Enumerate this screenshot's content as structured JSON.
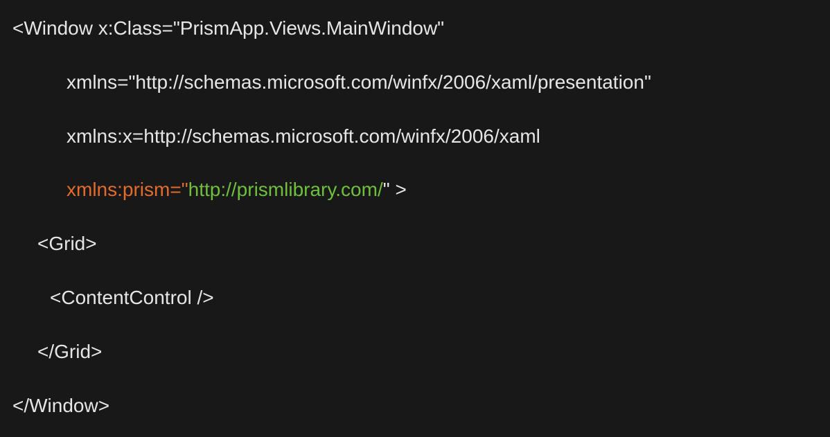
{
  "lines": {
    "l1": "<Window x:Class=\"PrismApp.Views.MainWindow\"",
    "l2": "xmlns=\"http://schemas.microsoft.com/winfx/2006/xaml/presentation\"",
    "l3": "xmlns:x=http://schemas.microsoft.com/winfx/2006/xaml",
    "l4a": "xmlns:prism=\"",
    "l4b": "http://prismlibrary.com/",
    "l4c": "\" >",
    "l5": "<Grid>",
    "l6": "<ContentControl />",
    "l7": "</Grid>",
    "l8": "</Window>"
  }
}
